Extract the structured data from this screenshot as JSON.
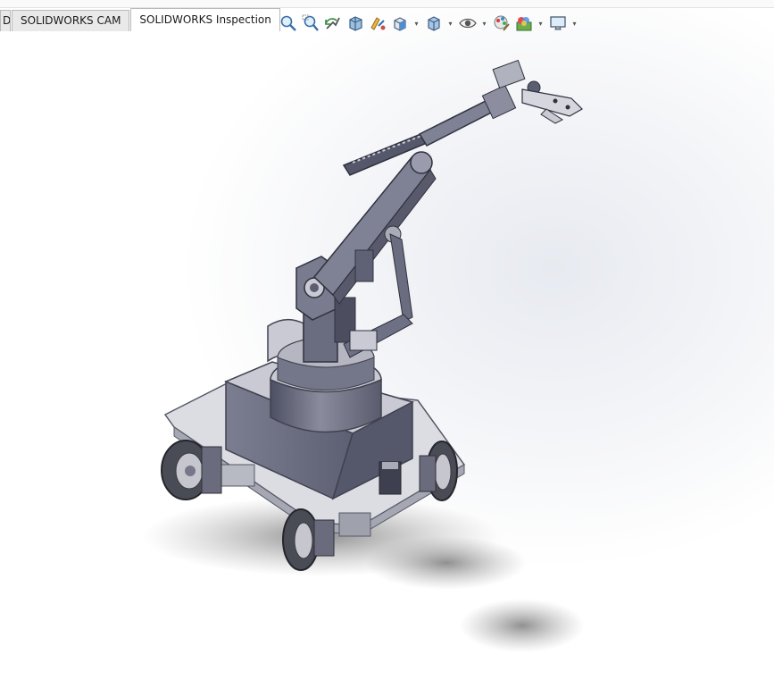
{
  "tabs": [
    {
      "label": "D",
      "active": false
    },
    {
      "label": "SOLIDWORKS CAM",
      "active": false
    },
    {
      "label": "SOLIDWORKS Inspection",
      "active": true
    }
  ],
  "heads_up_toolbar": [
    {
      "icon": "zoom-to-fit-icon"
    },
    {
      "icon": "zoom-to-area-icon"
    },
    {
      "icon": "previous-view-icon"
    },
    {
      "icon": "section-view-icon"
    },
    {
      "icon": "dynamic-annotation-view-icon"
    },
    {
      "icon": "view-orientation-icon",
      "dropdown": true
    },
    {
      "icon": "display-style-icon",
      "dropdown": true
    },
    {
      "icon": "hide-show-items-icon",
      "dropdown": true
    },
    {
      "icon": "edit-appearance-icon"
    },
    {
      "icon": "apply-scene-icon",
      "dropdown": true
    },
    {
      "icon": "view-settings-icon",
      "dropdown": true
    }
  ],
  "model": {
    "name": "mobile-robot-arm-assembly",
    "colors": {
      "metal_dark": "#5b5e70",
      "metal_light": "#c9cad3",
      "plate": "#dcdde2",
      "wheel": "#4a4c55"
    }
  }
}
